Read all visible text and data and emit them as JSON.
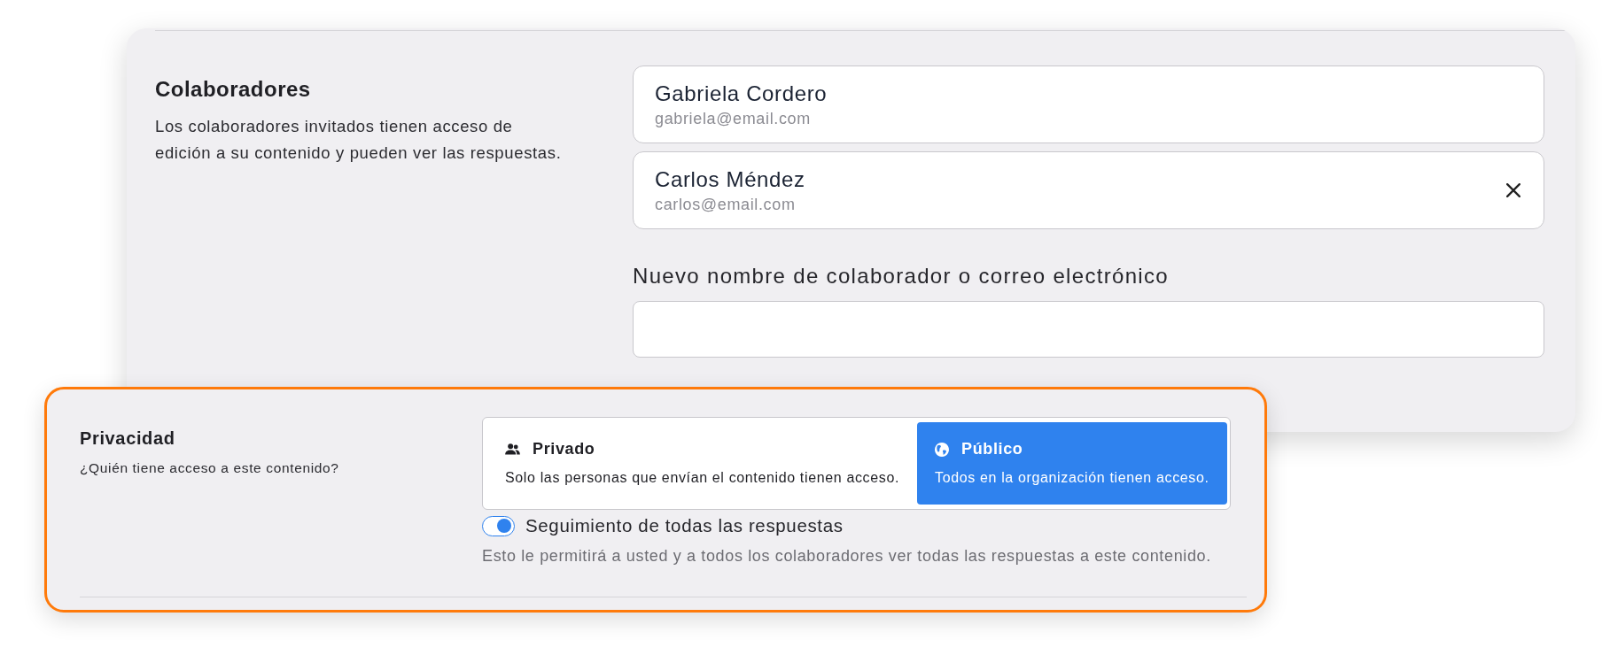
{
  "collaborators_section": {
    "title": "Colaboradores",
    "description": "Los colaboradores invitados tienen acceso de edición a su contenido y pueden ver las respuestas.",
    "collaborators": [
      {
        "name": "Gabriela Cordero",
        "email": "gabriela@email.com",
        "removable": false
      },
      {
        "name": "Carlos Méndez",
        "email": "carlos@email.com",
        "removable": true
      }
    ],
    "new_collaborator": {
      "label": "Nuevo nombre de colaborador o correo electrónico"
    }
  },
  "privacy_section": {
    "title": "Privacidad",
    "description": "¿Quién tiene acceso a este contenido?",
    "options": [
      {
        "kind": "private",
        "title": "Privado",
        "description": "Solo las personas que envían el contenido tienen acceso.",
        "selected": false
      },
      {
        "kind": "public",
        "title": "Público",
        "description": "Todos en la organización tienen acceso.",
        "selected": true
      }
    ],
    "follow_all": {
      "label": "Seguimiento de todas las respuestas",
      "on": true,
      "help": "Esto le permitirá a usted y a todos los colaboradores ver todas las respuestas a este contenido."
    }
  }
}
